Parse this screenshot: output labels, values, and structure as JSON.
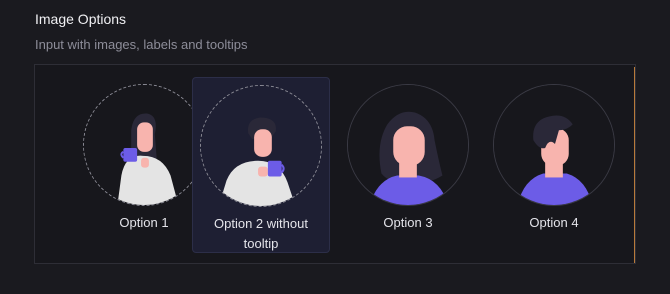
{
  "header": {
    "title": "Image Options",
    "subtitle": "Input with images, labels and tooltips"
  },
  "options": [
    {
      "label": "Option 1",
      "icon": "woman-coffee-avatar",
      "selected": false
    },
    {
      "label": "Option 2 without tooltip",
      "icon": "man-coffee-avatar",
      "selected": true
    },
    {
      "label": "Option 3",
      "icon": "woman-avatar",
      "selected": false
    },
    {
      "label": "Option 4",
      "icon": "man-avatar",
      "selected": false
    }
  ],
  "colors": {
    "background": "#1a1a1f",
    "selected_bg": "#1e1f33",
    "accent_purple": "#6c5ce7",
    "skin": "#f8b4ae",
    "hair": "#2a2838",
    "accent_bar": "#b87a3a"
  }
}
